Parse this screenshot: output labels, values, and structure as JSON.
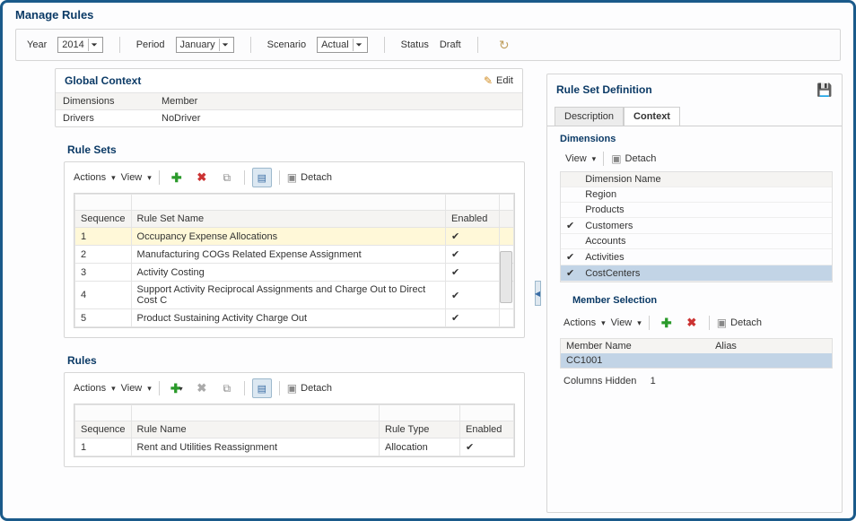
{
  "title": "Manage Rules",
  "filters": {
    "year_label": "Year",
    "year_value": "2014",
    "period_label": "Period",
    "period_value": "January",
    "scenario_label": "Scenario",
    "scenario_value": "Actual",
    "status_label": "Status",
    "status_value": "Draft"
  },
  "global_context": {
    "title": "Global Context",
    "edit_label": "Edit",
    "col_dimensions": "Dimensions",
    "col_member": "Member",
    "rows": [
      {
        "dimension": "Drivers",
        "member": "NoDriver"
      }
    ]
  },
  "rule_sets": {
    "title": "Rule Sets",
    "actions_label": "Actions",
    "view_label": "View",
    "detach_label": "Detach",
    "col_sequence": "Sequence",
    "col_name": "Rule Set Name",
    "col_enabled": "Enabled",
    "rows": [
      {
        "seq": "1",
        "name": "Occupancy Expense Allocations",
        "enabled": "✔"
      },
      {
        "seq": "2",
        "name": "Manufacturing COGs Related Expense Assignment",
        "enabled": "✔"
      },
      {
        "seq": "3",
        "name": "Activity Costing",
        "enabled": "✔"
      },
      {
        "seq": "4",
        "name": "Support Activity Reciprocal Assignments and Charge Out to Direct Cost C",
        "enabled": "✔"
      },
      {
        "seq": "5",
        "name": "Product Sustaining Activity Charge Out",
        "enabled": "✔"
      }
    ]
  },
  "rules": {
    "title": "Rules",
    "actions_label": "Actions",
    "view_label": "View",
    "detach_label": "Detach",
    "col_sequence": "Sequence",
    "col_name": "Rule Name",
    "col_type": "Rule Type",
    "col_enabled": "Enabled",
    "rows": [
      {
        "seq": "1",
        "name": "Rent and Utilities Reassignment",
        "type": "Allocation",
        "enabled": "✔"
      }
    ]
  },
  "rsd": {
    "title": "Rule Set Definition",
    "tab_desc": "Description",
    "tab_context": "Context",
    "dimensions_title": "Dimensions",
    "view_label": "View",
    "detach_label": "Detach",
    "col_dim_name": "Dimension Name",
    "dims": [
      {
        "checked": "",
        "name": "Region"
      },
      {
        "checked": "",
        "name": "Products"
      },
      {
        "checked": "✔",
        "name": "Customers"
      },
      {
        "checked": "",
        "name": "Accounts"
      },
      {
        "checked": "✔",
        "name": "Activities"
      },
      {
        "checked": "✔",
        "name": "CostCenters",
        "selected": true
      }
    ],
    "member_sel_title": "Member Selection",
    "actions_label": "Actions",
    "col_member_name": "Member Name",
    "col_alias": "Alias",
    "members": [
      {
        "name": "CC1001",
        "alias": ""
      }
    ],
    "cols_hidden_label": "Columns Hidden",
    "cols_hidden_value": "1"
  }
}
